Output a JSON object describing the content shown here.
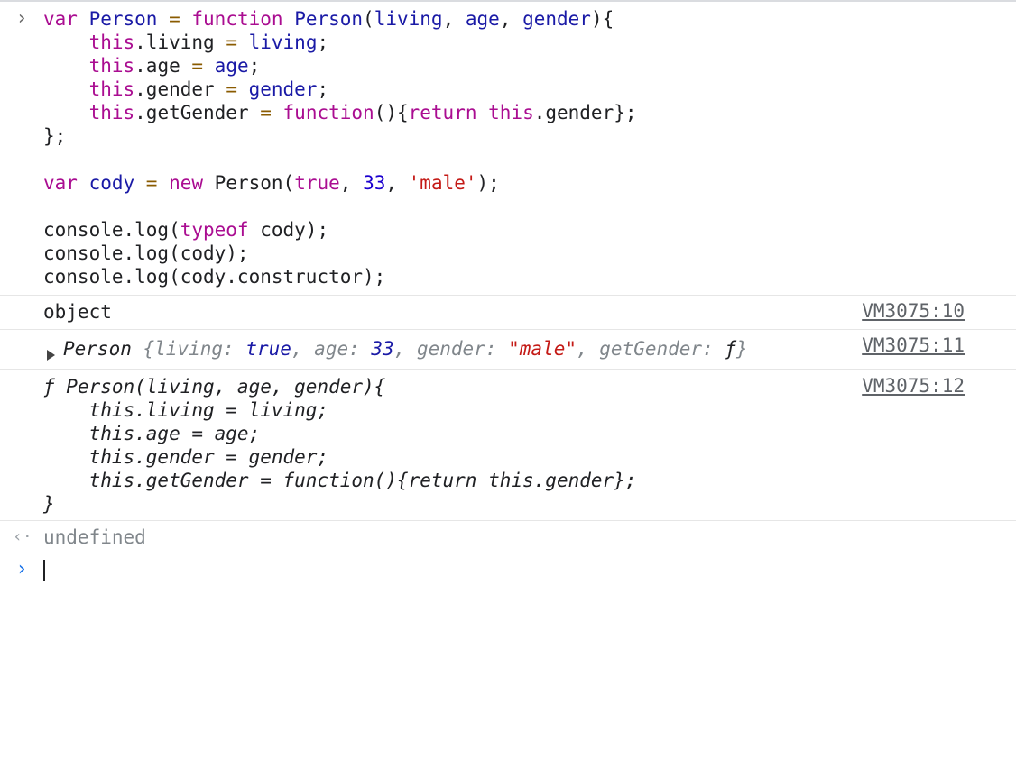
{
  "input": {
    "prompt_icon": "chevron-right-icon",
    "lines": [
      [
        {
          "t": "var ",
          "c": "k"
        },
        {
          "t": "Person ",
          "c": "v"
        },
        {
          "t": "= ",
          "c": "o"
        },
        {
          "t": "function ",
          "c": "k"
        },
        {
          "t": "Person",
          "c": "v"
        },
        {
          "t": "(",
          "c": "p"
        },
        {
          "t": "living",
          "c": "v"
        },
        {
          "t": ", ",
          "c": "p"
        },
        {
          "t": "age",
          "c": "v"
        },
        {
          "t": ", ",
          "c": "p"
        },
        {
          "t": "gender",
          "c": "v"
        },
        {
          "t": "){",
          "c": "p"
        }
      ],
      [
        {
          "t": "    ",
          "c": "p"
        },
        {
          "t": "this",
          "c": "k"
        },
        {
          "t": ".living ",
          "c": "p"
        },
        {
          "t": "= ",
          "c": "o"
        },
        {
          "t": "living",
          "c": "v"
        },
        {
          "t": ";",
          "c": "p"
        }
      ],
      [
        {
          "t": "    ",
          "c": "p"
        },
        {
          "t": "this",
          "c": "k"
        },
        {
          "t": ".age ",
          "c": "p"
        },
        {
          "t": "= ",
          "c": "o"
        },
        {
          "t": "age",
          "c": "v"
        },
        {
          "t": ";",
          "c": "p"
        }
      ],
      [
        {
          "t": "    ",
          "c": "p"
        },
        {
          "t": "this",
          "c": "k"
        },
        {
          "t": ".gender ",
          "c": "p"
        },
        {
          "t": "= ",
          "c": "o"
        },
        {
          "t": "gender",
          "c": "v"
        },
        {
          "t": ";",
          "c": "p"
        }
      ],
      [
        {
          "t": "    ",
          "c": "p"
        },
        {
          "t": "this",
          "c": "k"
        },
        {
          "t": ".getGender ",
          "c": "p"
        },
        {
          "t": "= ",
          "c": "o"
        },
        {
          "t": "function",
          "c": "k"
        },
        {
          "t": "(){",
          "c": "p"
        },
        {
          "t": "return ",
          "c": "k"
        },
        {
          "t": "this",
          "c": "k"
        },
        {
          "t": ".gender};",
          "c": "p"
        }
      ],
      [
        {
          "t": "};",
          "c": "p"
        }
      ],
      [
        {
          "t": "",
          "c": "p"
        }
      ],
      [
        {
          "t": "var ",
          "c": "k"
        },
        {
          "t": "cody ",
          "c": "v"
        },
        {
          "t": "= ",
          "c": "o"
        },
        {
          "t": "new ",
          "c": "k"
        },
        {
          "t": "Person(",
          "c": "p"
        },
        {
          "t": "true",
          "c": "k"
        },
        {
          "t": ", ",
          "c": "p"
        },
        {
          "t": "33",
          "c": "n"
        },
        {
          "t": ", ",
          "c": "p"
        },
        {
          "t": "'male'",
          "c": "s"
        },
        {
          "t": ");",
          "c": "p"
        }
      ],
      [
        {
          "t": "",
          "c": "p"
        }
      ],
      [
        {
          "t": "console.log(",
          "c": "p"
        },
        {
          "t": "typeof ",
          "c": "k"
        },
        {
          "t": "cody);",
          "c": "p"
        }
      ],
      [
        {
          "t": "console.log(cody);",
          "c": "p"
        }
      ],
      [
        {
          "t": "console.log(cody.constructor);",
          "c": "p"
        }
      ]
    ]
  },
  "outputs": [
    {
      "text": "object",
      "source": "VM3075:10"
    },
    {
      "source": "VM3075:11",
      "parts": [
        {
          "t": "Person ",
          "c": "p"
        },
        {
          "t": "{living: ",
          "c": "dim"
        },
        {
          "t": "true",
          "c": "v"
        },
        {
          "t": ", age: ",
          "c": "dim"
        },
        {
          "t": "33",
          "c": "v"
        },
        {
          "t": ", gender: ",
          "c": "dim"
        },
        {
          "t": "\"male\"",
          "c": "s"
        },
        {
          "t": ", getGender: ",
          "c": "dim"
        },
        {
          "t": "ƒ",
          "c": "p"
        },
        {
          "t": "}",
          "c": "dim"
        }
      ]
    },
    {
      "source": "VM3075:12",
      "lines": [
        "ƒ Person(living, age, gender){",
        "    this.living = living;",
        "    this.age = age;",
        "    this.gender = gender;",
        "    this.getGender = function(){return this.gender};",
        "}"
      ]
    }
  ],
  "return_value": {
    "icon": "return-arrow-icon",
    "text": "undefined"
  },
  "prompt": {
    "icon": "chevron-right-icon",
    "value": ""
  },
  "colors": {
    "prompt_blue": "#1a73e8",
    "keyword": "#aa0d91",
    "string": "#c41a16",
    "number": "#1c00cf"
  }
}
